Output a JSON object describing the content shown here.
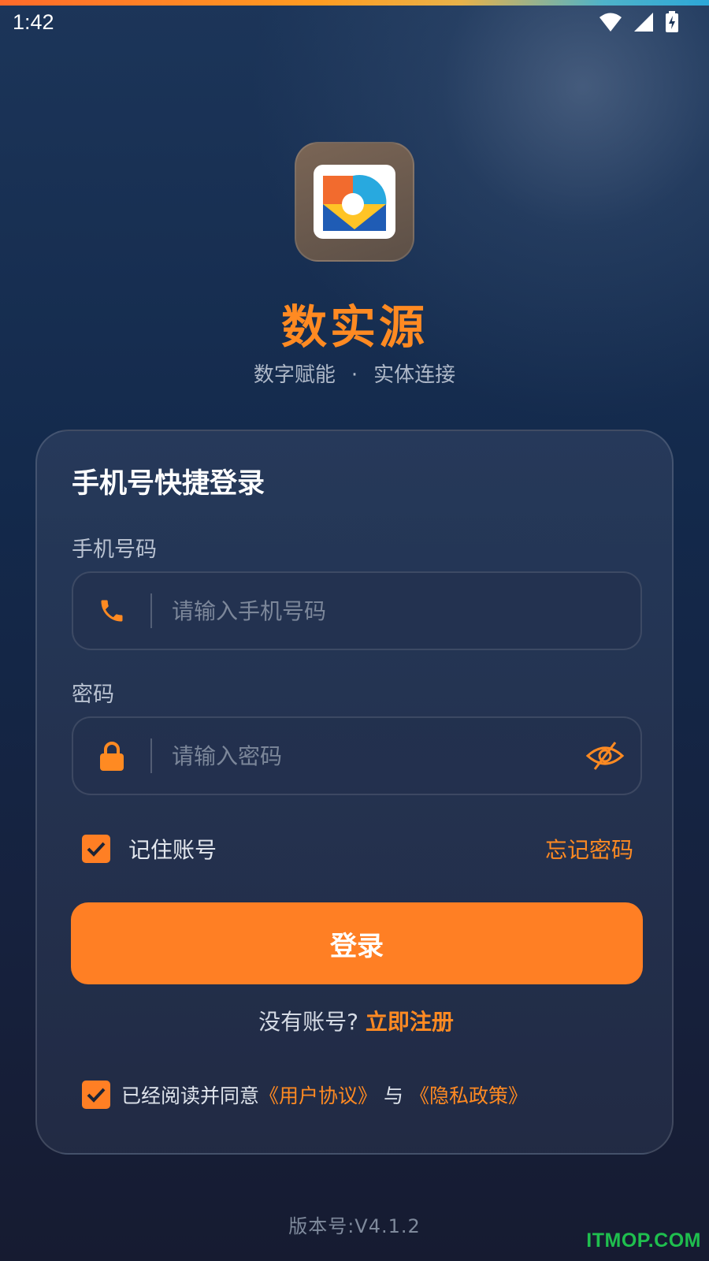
{
  "status_bar": {
    "time": "1:42",
    "icons": [
      "wifi-icon",
      "signal-icon",
      "battery-charging-icon"
    ]
  },
  "app": {
    "logo_icon": "app-logo-icon",
    "name": "数实源",
    "slogan_left": "数字赋能",
    "slogan_dot": "·",
    "slogan_right": "实体连接"
  },
  "login": {
    "title": "手机号快捷登录",
    "phone_label": "手机号码",
    "phone_placeholder": "请输入手机号码",
    "phone_value": "",
    "phone_icon": "phone-icon",
    "password_label": "密码",
    "password_placeholder": "请输入密码",
    "password_value": "",
    "password_icon": "lock-icon",
    "visibility_icon": "eye-off-icon",
    "remember_label": "记住账号",
    "remember_checked": true,
    "forgot_label": "忘记密码",
    "submit_label": "登录",
    "register_prompt": "没有账号?",
    "register_link": "立即注册",
    "agree_checked": true,
    "agree_text": "已经阅读并同意",
    "user_agreement": "《用户协议》",
    "agree_and": "与",
    "privacy_policy": "《隐私政策》"
  },
  "footer": {
    "version": "版本号:V4.1.2",
    "watermark": "ITMOP.COM"
  },
  "colors": {
    "accent": "#ff7f24",
    "background_top": "#1c3559",
    "background_bottom": "#161b31",
    "watermark": "#1fbf4e"
  }
}
